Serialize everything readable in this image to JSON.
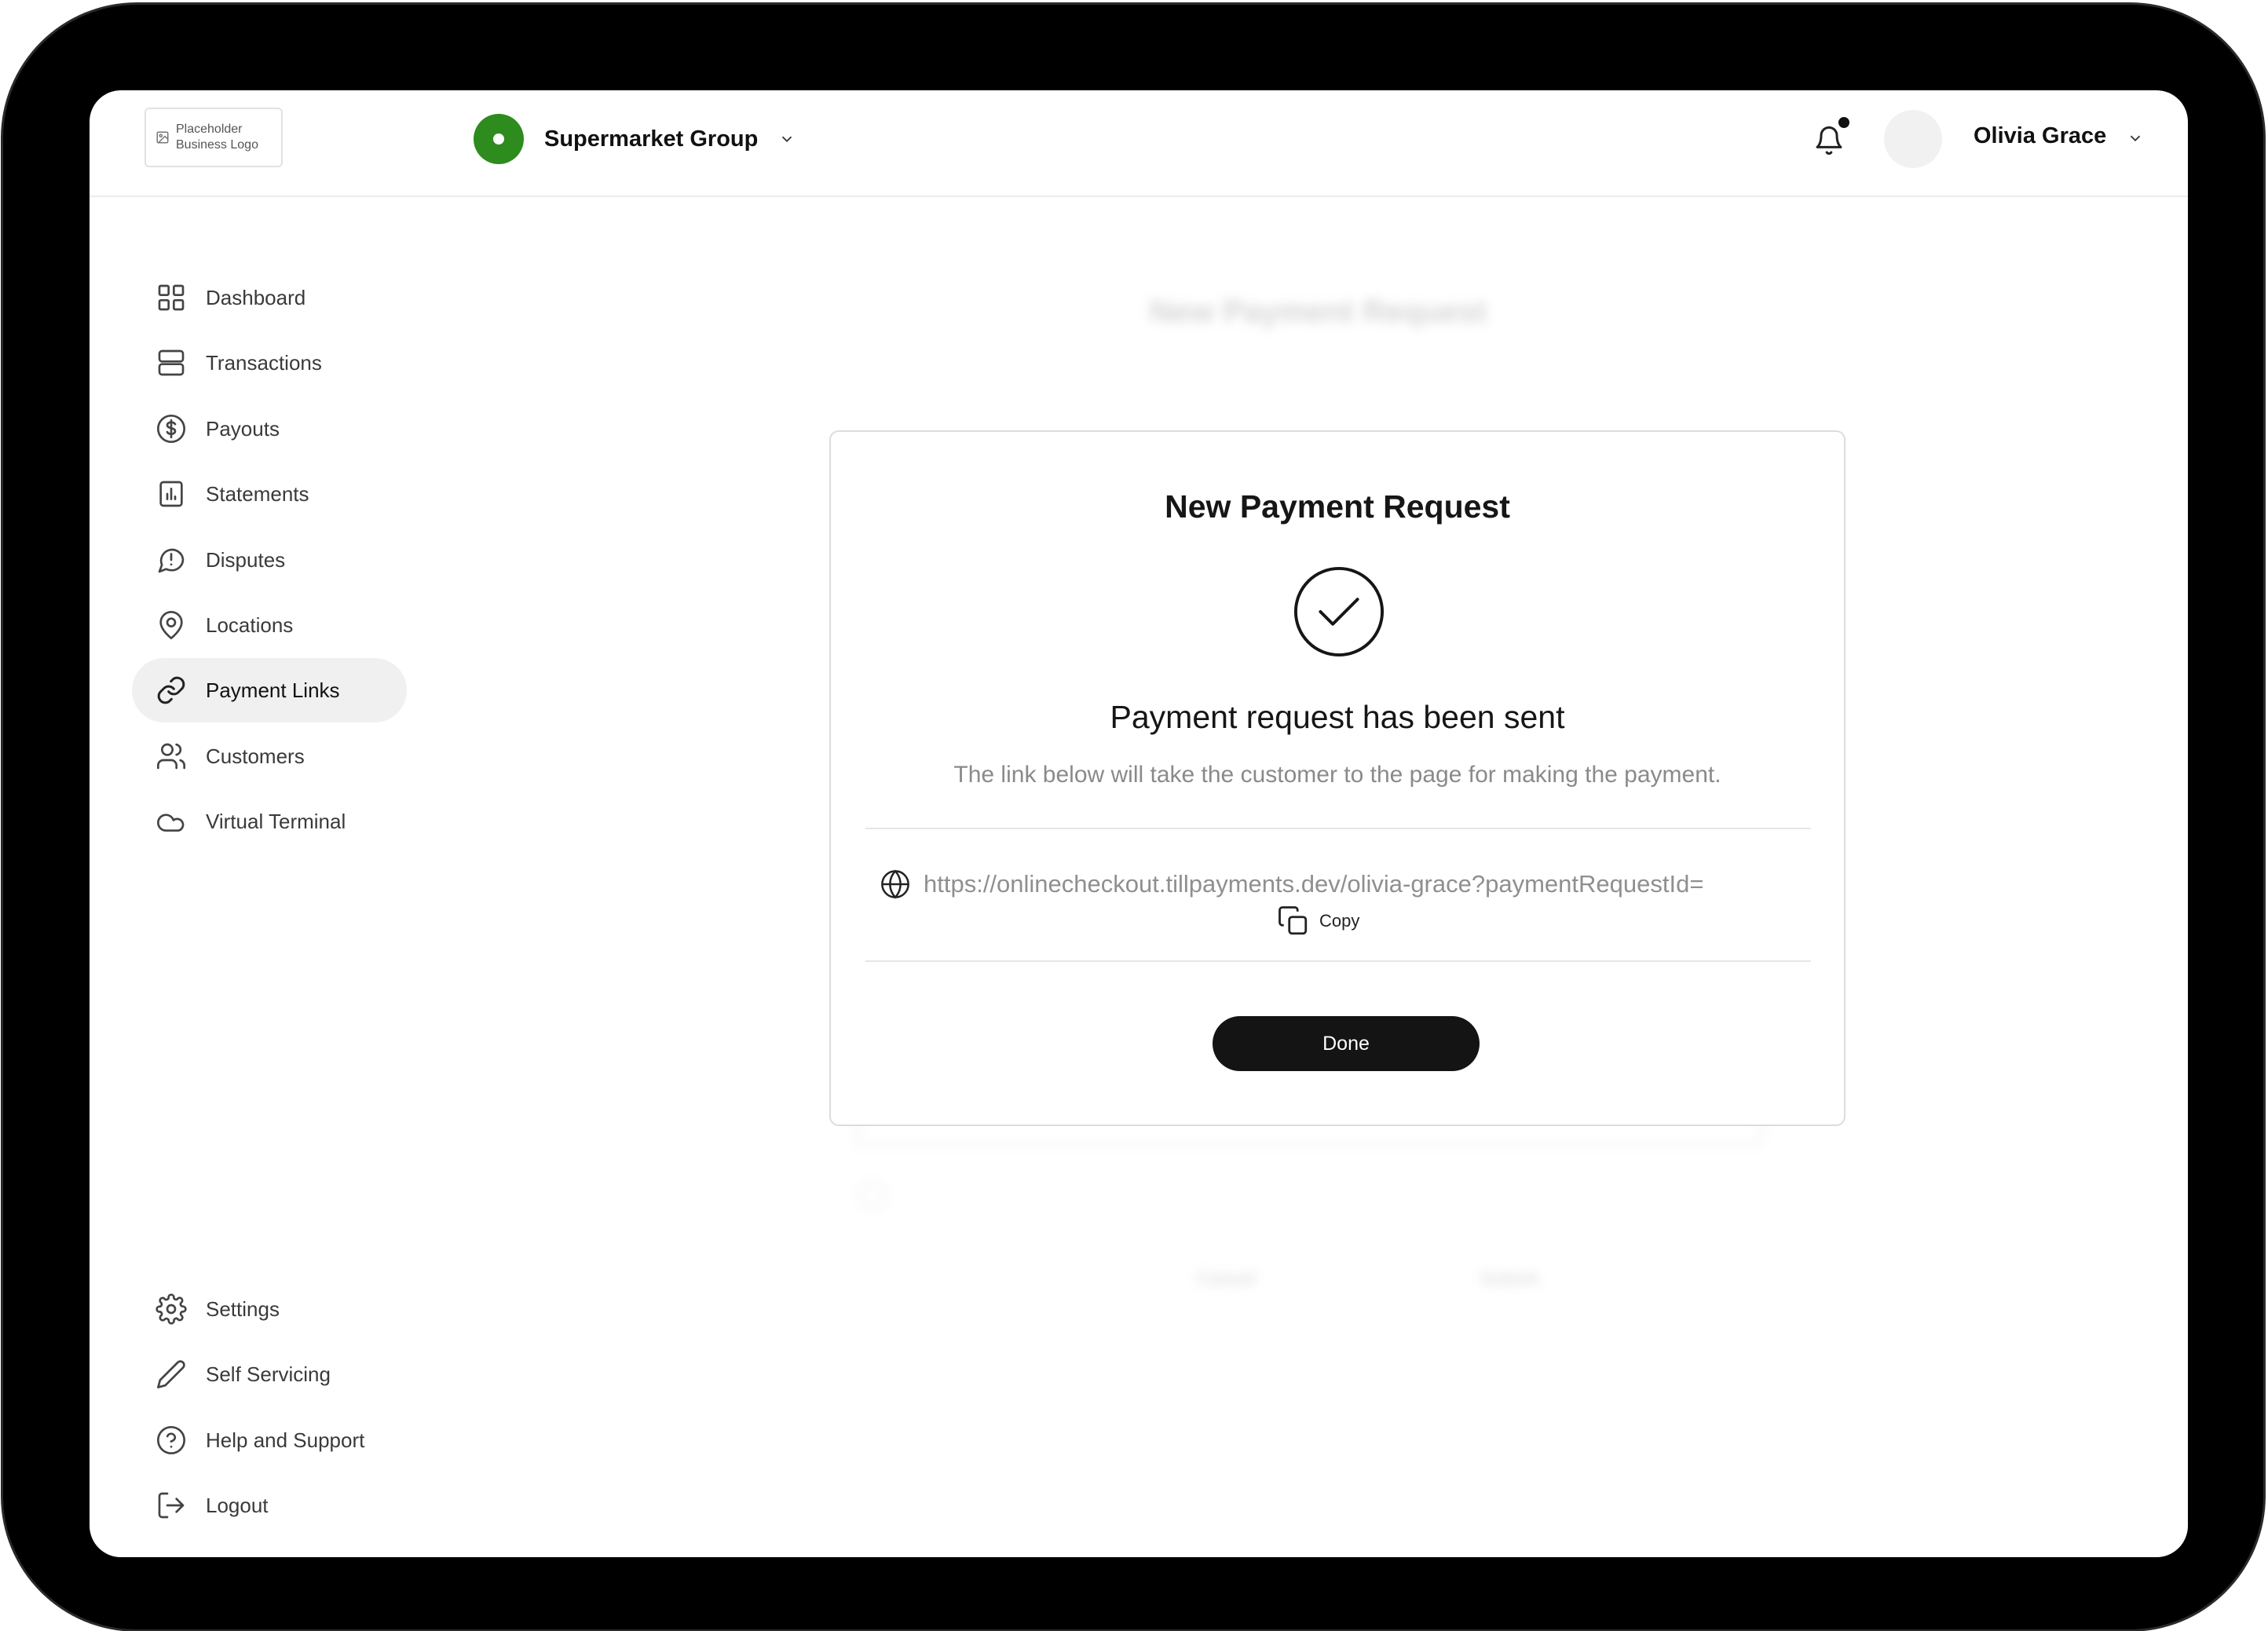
{
  "header": {
    "logo_text_line1": "Placeholder",
    "logo_text_line2": "Business Logo",
    "group_name": "Supermarket Group",
    "user_name": "Olivia Grace",
    "brand_color": "#2e8b1e"
  },
  "sidebar": {
    "items": [
      {
        "label": "Dashboard",
        "icon": "grid-icon"
      },
      {
        "label": "Transactions",
        "icon": "server-icon"
      },
      {
        "label": "Payouts",
        "icon": "dollar-circle-icon"
      },
      {
        "label": "Statements",
        "icon": "bar-chart-icon"
      },
      {
        "label": "Disputes",
        "icon": "message-alert-icon"
      },
      {
        "label": "Locations",
        "icon": "map-pin-icon"
      },
      {
        "label": "Payment Links",
        "icon": "link-icon",
        "active": true
      },
      {
        "label": "Customers",
        "icon": "users-icon"
      },
      {
        "label": "Virtual Terminal",
        "icon": "cloud-icon"
      }
    ],
    "bottom_items": [
      {
        "label": "Settings",
        "icon": "gear-icon"
      },
      {
        "label": "Self Servicing",
        "icon": "pencil-icon"
      },
      {
        "label": "Help and Support",
        "icon": "help-circle-icon"
      },
      {
        "label": "Logout",
        "icon": "logout-icon"
      }
    ]
  },
  "background_form": {
    "title": "New Payment Request",
    "cancel_label": "Cancel",
    "submit_label": "Submit"
  },
  "modal": {
    "title": "New Payment Request",
    "status_title": "Payment request has been sent",
    "description": "The link below will take the customer to the page for making the payment.",
    "link_url": "https://onlinecheckout.tillpayments.dev/olivia-grace?paymentRequestId=",
    "copy_label": "Copy",
    "done_label": "Done"
  }
}
